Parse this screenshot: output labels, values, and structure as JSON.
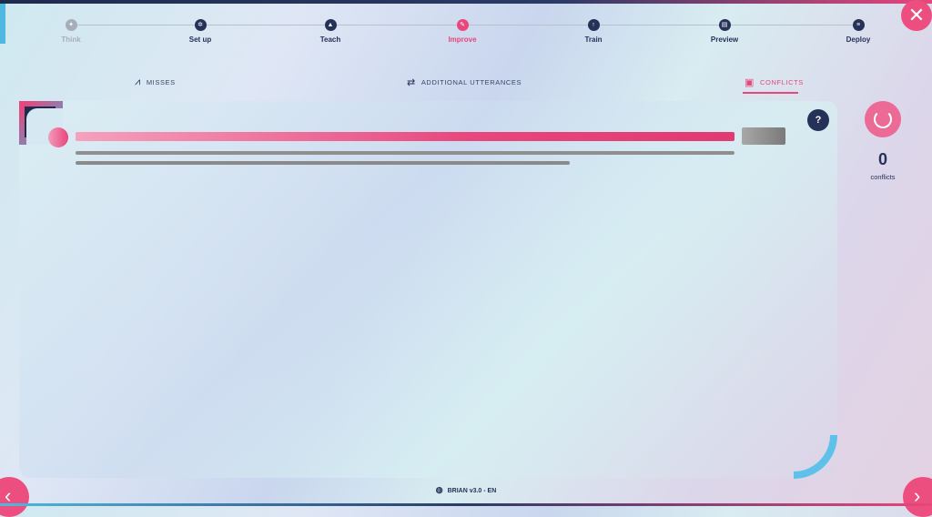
{
  "stepper": {
    "steps": [
      {
        "label": "Think",
        "state": "disabled",
        "icon": "lightbulb-icon"
      },
      {
        "label": "Set up",
        "state": "normal",
        "icon": "gear-icon"
      },
      {
        "label": "Teach",
        "state": "normal",
        "icon": "graduation-cap-icon"
      },
      {
        "label": "Improve",
        "state": "active",
        "icon": "pencil-icon"
      },
      {
        "label": "Train",
        "state": "normal",
        "icon": "cloud-upload-icon"
      },
      {
        "label": "Preview",
        "state": "normal",
        "icon": "browser-window-icon"
      },
      {
        "label": "Deploy",
        "state": "normal",
        "icon": "stack-icon"
      }
    ]
  },
  "tabs": [
    {
      "label": "MISSES",
      "icon": "chart-dip-icon",
      "active": false
    },
    {
      "label": "ADDITIONAL UTTERANCES",
      "icon": "repeat-icon",
      "active": false
    },
    {
      "label": "CONFLICTS",
      "icon": "robot-icon",
      "active": true
    }
  ],
  "conflicts": {
    "count": "0",
    "label": "conflicts"
  },
  "help": {
    "glyph": "?"
  },
  "footer": {
    "text": "BRIAN v3.0 - EN",
    "icon": "globe-icon"
  },
  "colors": {
    "primary": "#263157",
    "accent": "#e8467c",
    "highlight": "#5ec1ea"
  }
}
